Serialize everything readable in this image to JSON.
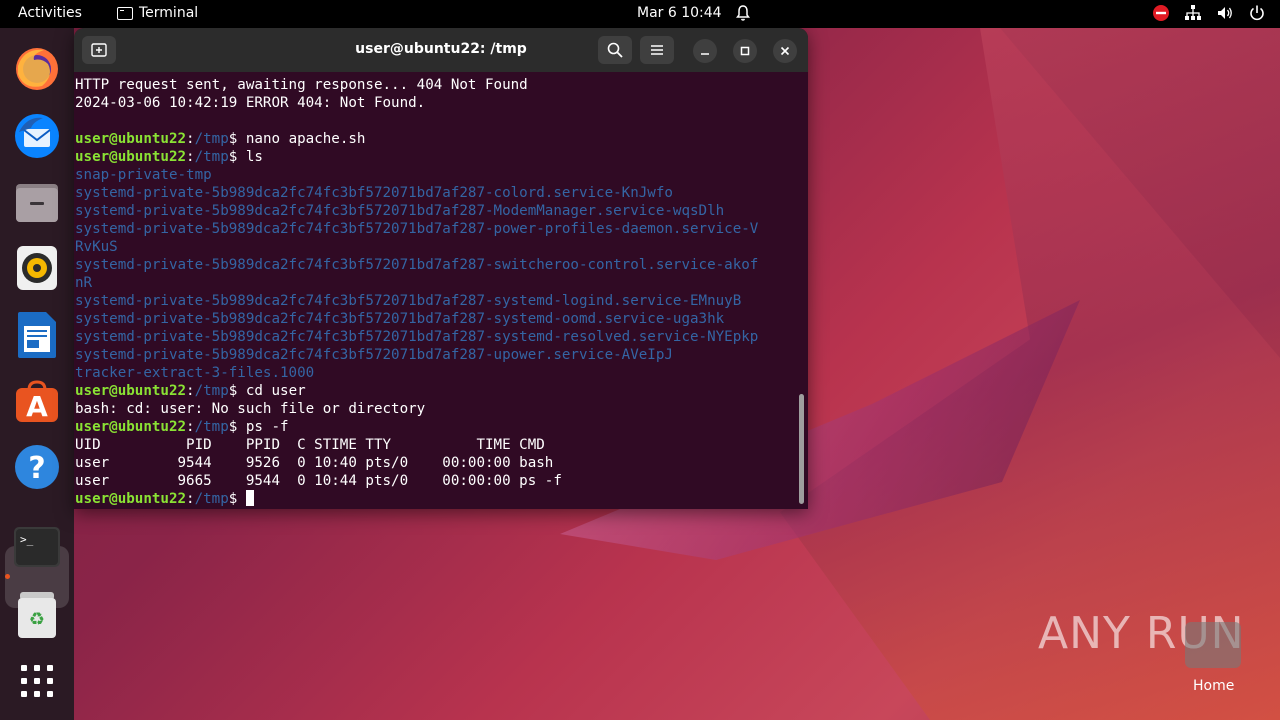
{
  "topbar": {
    "activities": "Activities",
    "app_name": "Terminal",
    "clock": "Mar 6  10:44"
  },
  "dock": {
    "items": [
      "firefox",
      "thunderbird",
      "files",
      "rhythmbox",
      "libreoffice-writer",
      "app-center",
      "help",
      "terminal",
      "trash",
      "show-apps"
    ]
  },
  "window": {
    "title": "user@ubuntu22: /tmp"
  },
  "terminal": {
    "prompt_user": "user@ubuntu22",
    "prompt_sep": ":",
    "prompt_dir": "/tmp",
    "prompt_end": "$ ",
    "lines": [
      {
        "kind": "out",
        "text": "HTTP request sent, awaiting response... 404 Not Found"
      },
      {
        "kind": "out",
        "text": "2024-03-06 10:42:19 ERROR 404: Not Found."
      },
      {
        "kind": "out",
        "text": ""
      },
      {
        "kind": "cmd",
        "text": "nano apache.sh"
      },
      {
        "kind": "cmd",
        "text": "ls"
      },
      {
        "kind": "dir",
        "text": "snap-private-tmp"
      },
      {
        "kind": "dir",
        "text": "systemd-private-5b989dca2fc74fc3bf572071bd7af287-colord.service-KnJwfo"
      },
      {
        "kind": "dir",
        "text": "systemd-private-5b989dca2fc74fc3bf572071bd7af287-ModemManager.service-wqsDlh"
      },
      {
        "kind": "dir",
        "text": "systemd-private-5b989dca2fc74fc3bf572071bd7af287-power-profiles-daemon.service-V"
      },
      {
        "kind": "dir",
        "text": "RvKuS"
      },
      {
        "kind": "dir",
        "text": "systemd-private-5b989dca2fc74fc3bf572071bd7af287-switcheroo-control.service-akof"
      },
      {
        "kind": "dir",
        "text": "nR"
      },
      {
        "kind": "dir",
        "text": "systemd-private-5b989dca2fc74fc3bf572071bd7af287-systemd-logind.service-EMnuyB"
      },
      {
        "kind": "dir",
        "text": "systemd-private-5b989dca2fc74fc3bf572071bd7af287-systemd-oomd.service-uga3hk"
      },
      {
        "kind": "dir",
        "text": "systemd-private-5b989dca2fc74fc3bf572071bd7af287-systemd-resolved.service-NYEpkp"
      },
      {
        "kind": "dir",
        "text": "systemd-private-5b989dca2fc74fc3bf572071bd7af287-upower.service-AVeIpJ"
      },
      {
        "kind": "dir",
        "text": "tracker-extract-3-files.1000"
      },
      {
        "kind": "cmd",
        "text": "cd user"
      },
      {
        "kind": "out",
        "text": "bash: cd: user: No such file or directory"
      },
      {
        "kind": "cmd",
        "text": "ps -f"
      },
      {
        "kind": "out",
        "text": "UID          PID    PPID  C STIME TTY          TIME CMD"
      },
      {
        "kind": "out",
        "text": "user        9544    9526  0 10:40 pts/0    00:00:00 bash"
      },
      {
        "kind": "out",
        "text": "user        9665    9544  0 10:44 pts/0    00:00:00 ps -f"
      },
      {
        "kind": "prompt",
        "text": ""
      }
    ]
  },
  "desktop": {
    "watermark": "ANY RUN",
    "home_label": "Home"
  },
  "colors": {
    "terminal_bg": "#300a24",
    "prompt_green": "#8ae234",
    "dir_blue": "#3465a4",
    "accent": "#e95420"
  }
}
